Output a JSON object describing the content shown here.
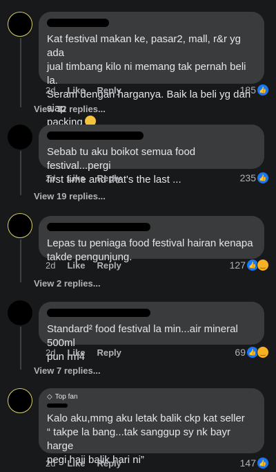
{
  "comments": [
    {
      "text": "Kat festival makan ke, pasar2, mall, r&r yg ada\njual timbang kilo ni memang tak pernah beli la.\nSeram dengan harganya. Baik la beli yg dah siap\npacking",
      "time": "2d",
      "like": "Like",
      "reply": "Reply",
      "reaction_count": "185",
      "view_replies": "View 32 replies...",
      "emoji": "grinning-emoji"
    },
    {
      "text": "Sebab tu aku boikot semua food festival...pergi\nfirst time and that's the last ...",
      "time": "2d",
      "like": "Like",
      "reply": "Reply",
      "reaction_count": "235",
      "view_replies": "View 19 replies..."
    },
    {
      "text": "Lepas tu peniaga food festival hairan kenapa\ntakde pengunjung.",
      "time": "2d",
      "like": "Like",
      "reply": "Reply",
      "reaction_count": "127",
      "view_replies": "View 2 replies..."
    },
    {
      "text": "Standard² food festival la min...air mineral 500ml\npun rm4",
      "time": "2d",
      "like": "Like",
      "reply": "Reply",
      "reaction_count": "69",
      "view_replies": "View 7 replies..."
    },
    {
      "badge": "Top fan",
      "text": "Kalo aku,mmg aku letak balik ckp kat seller\n“ takpe la bang...tak sanggup sy nk bayr harge\npegi haji balik hari ni”",
      "time": "2d",
      "like": "Like",
      "reply": "Reply",
      "reaction_count": "147"
    }
  ],
  "icons": {
    "like": "like-icon",
    "haha": "haha-icon",
    "topfan": "diamond-icon"
  },
  "colors": {
    "background": "#18191a",
    "bubble": "#3a3b3c",
    "like_blue": "#1877f2"
  }
}
